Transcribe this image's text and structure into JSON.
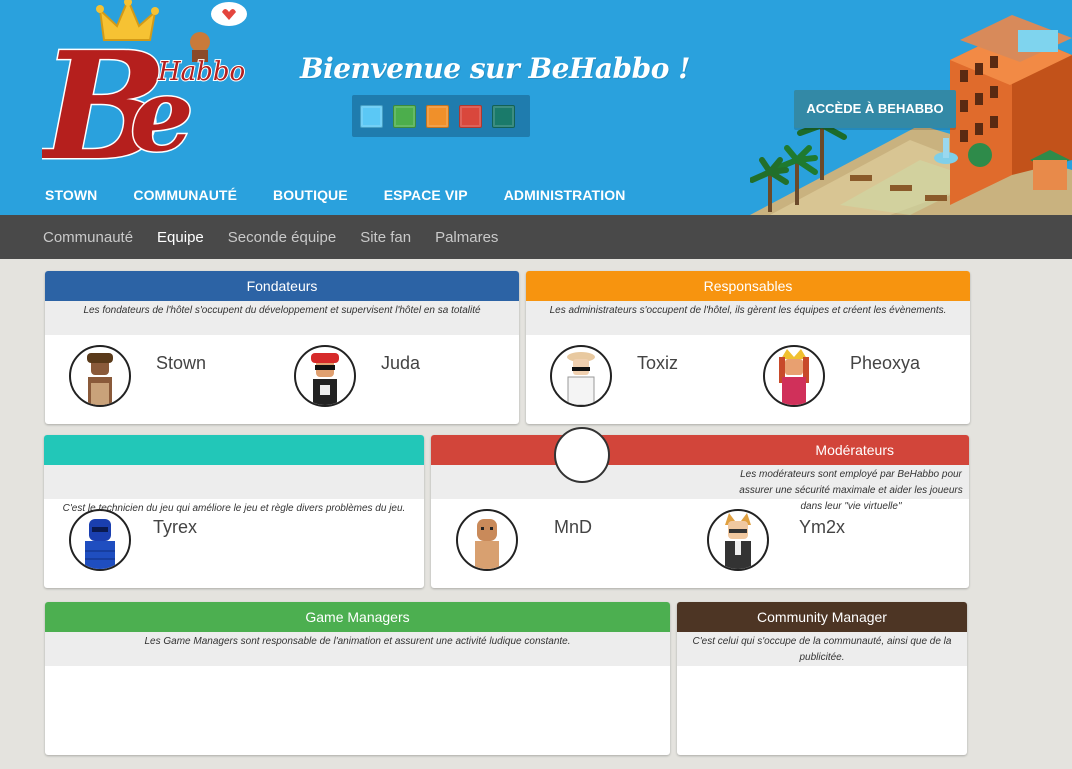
{
  "header": {
    "logo_letters": "Be",
    "logo_sub": "Habbo",
    "welcome": "Bienvenue sur BeHabbo !",
    "access_button": "ACCÈDE À BEHABBO",
    "theme_colors": [
      "#5bc8f5",
      "#4cae4c",
      "#f0902a",
      "#d9473c",
      "#1a7a6a"
    ]
  },
  "main_nav": [
    "STOWN",
    "COMMUNAUTÉ",
    "BOUTIQUE",
    "ESPACE VIP",
    "ADMINISTRATION"
  ],
  "sub_nav": {
    "items": [
      "Communauté",
      "Equipe",
      "Seconde équipe",
      "Site fan",
      "Palmares"
    ],
    "active": "Equipe"
  },
  "panels": {
    "fondateurs": {
      "title": "Fondateurs",
      "color": "#2c63a5",
      "description": "Les fondateurs de l'hôtel s'occupent du développement et supervisent l'hôtel en sa totalité",
      "members": [
        "Stown",
        "Juda"
      ]
    },
    "responsables": {
      "title": "Responsables",
      "color": "#f7940f",
      "description": "Les administrateurs s'occupent de l'hôtel, ils gèrent les équipes et créent les évènements.",
      "members": [
        "Toxiz",
        "Pheoxya"
      ]
    },
    "technicien": {
      "title": "",
      "color": "#22c7b8",
      "description": "C'est le technicien du jeu qui améliore le jeu et règle divers problèmes du jeu.",
      "members": [
        "Tyrex"
      ]
    },
    "moderateurs": {
      "title": "Modérateurs",
      "color": "#d2453a",
      "description": "Les modérateurs sont employé par BeHabbo pour assurer une sécurité maximale et aider les joueurs dans leur \"vie virtuelle\"",
      "members": [
        "MnD",
        "Ym2x"
      ]
    },
    "game_managers": {
      "title": "Game Managers",
      "color": "#4caf50",
      "description": "Les Game Managers sont responsable de l'animation et assurent une activité ludique constante."
    },
    "community_manager": {
      "title": "Community Manager",
      "color": "#4d3524",
      "description": "C'est celui qui s'occupe de la communauté, ainsi que de la publicitée."
    }
  }
}
